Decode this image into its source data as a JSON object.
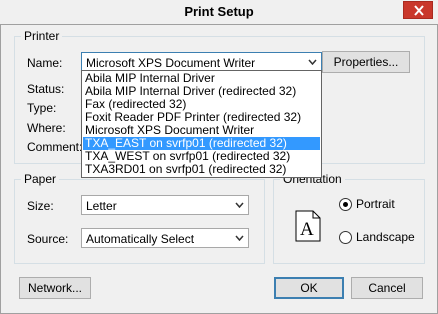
{
  "window": {
    "title": "Print Setup"
  },
  "printer": {
    "legend": "Printer",
    "name_label": "Name:",
    "name_value": "Microsoft XPS Document Writer",
    "properties_label": "Properties...",
    "status_label": "Status:",
    "type_label": "Type:",
    "where_label": "Where:",
    "comment_label": "Comment:",
    "dropdown_items": [
      {
        "label": "Abila MIP Internal Driver",
        "highlighted": false
      },
      {
        "label": "Abila MIP Internal Driver (redirected 32)",
        "highlighted": false
      },
      {
        "label": "Fax (redirected 32)",
        "highlighted": false
      },
      {
        "label": "Foxit Reader PDF Printer (redirected 32)",
        "highlighted": false
      },
      {
        "label": "Microsoft XPS Document Writer",
        "highlighted": false
      },
      {
        "label": "TXA_EAST on svrfp01 (redirected 32)",
        "highlighted": true
      },
      {
        "label": "TXA_WEST on svrfp01 (redirected 32)",
        "highlighted": false
      },
      {
        "label": "TXA3RD01 on svrfp01 (redirected 32)",
        "highlighted": false
      }
    ]
  },
  "paper": {
    "legend": "Paper",
    "size_label": "Size:",
    "size_value": "Letter",
    "source_label": "Source:",
    "source_value": "Automatically Select"
  },
  "orientation": {
    "legend": "Orientation",
    "portrait_label": "Portrait",
    "landscape_label": "Landscape",
    "selected": "Portrait",
    "page_glyph": "A"
  },
  "footer": {
    "network_label": "Network...",
    "ok_label": "OK",
    "cancel_label": "Cancel"
  },
  "colors": {
    "highlight": "#3399ff",
    "close": "#c9372b"
  }
}
